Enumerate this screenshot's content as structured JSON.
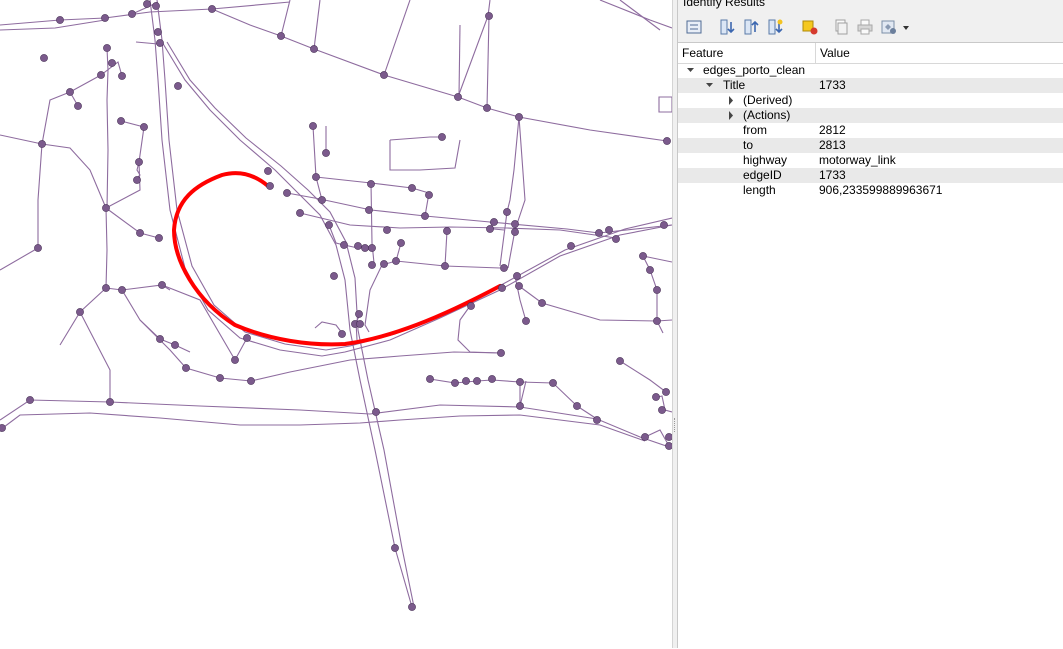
{
  "panel": {
    "title": "Identify Results",
    "toolbar": [
      {
        "name": "expand-tree-button",
        "icon": "expand-tree-icon"
      },
      {
        "name": "expand-all-button",
        "icon": "expand-all-icon"
      },
      {
        "name": "collapse-all-button",
        "icon": "collapse-all-icon"
      },
      {
        "name": "expand-new-button",
        "icon": "expand-new-icon"
      },
      {
        "name": "clear-highlight-button",
        "icon": "clear-highlight-icon"
      },
      {
        "name": "copy-feature-button",
        "icon": "copy-icon"
      },
      {
        "name": "print-button",
        "icon": "print-icon"
      },
      {
        "name": "identify-mode-button",
        "icon": "identify-settings-icon"
      }
    ],
    "columns": {
      "feature": "Feature",
      "value": "Value"
    },
    "layer": {
      "name": "edges_porto_clean"
    },
    "title_row": {
      "label": "Title",
      "value": "1733"
    },
    "derived_label": "(Derived)",
    "actions_label": "(Actions)",
    "attributes": [
      {
        "name": "from",
        "value": "2812"
      },
      {
        "name": "to",
        "value": "2813"
      },
      {
        "name": "highway",
        "value": "motorway_link"
      },
      {
        "name": "edgeID",
        "value": "1733"
      },
      {
        "name": "length",
        "value": "906,233599889963671"
      }
    ]
  },
  "map": {
    "road_color": "#7b5a8c",
    "node_color": "#7b5a8c",
    "highlight_color": "#ff0000"
  }
}
